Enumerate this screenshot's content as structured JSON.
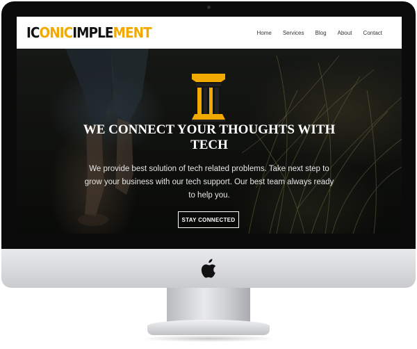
{
  "site": {
    "logo": {
      "part1": "IC",
      "part2": "ONIC",
      "part3": "IMPLE",
      "part4": "MENT"
    },
    "nav": [
      "Home",
      "Services",
      "Blog",
      "About",
      "Contact"
    ]
  },
  "hero": {
    "title_line1": "WE CONNECT YOUR THOUGHTS WITH",
    "title_line2": "TECH",
    "text": "We provide best solution of tech related problems. Take next step to grow your business with our tech support. Our best team always ready to help you.",
    "button_label": "STAY CONNECTED"
  },
  "icons": [
    "pillar-logo-icon",
    "apple-icon"
  ],
  "colors": {
    "accent": "#f2a900",
    "header_bg": "#ffffff",
    "hero_text": "#ffffff"
  }
}
